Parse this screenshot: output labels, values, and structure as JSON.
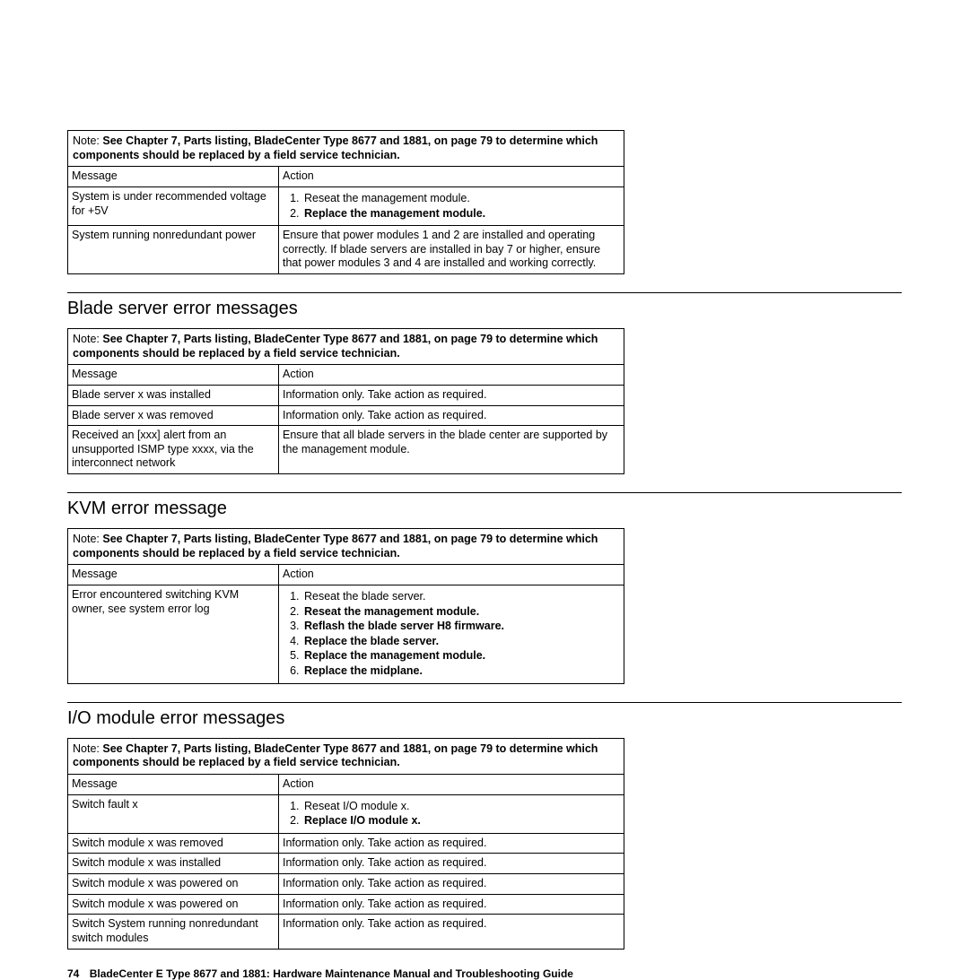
{
  "note": {
    "label": "Note:",
    "text": "See Chapter 7, Parts listing, BladeCenter Type 8677 and 1881, on page 79 to determine which components should be replaced by a field service technician."
  },
  "headers": {
    "message": "Message",
    "action": "Action"
  },
  "sections": [
    {
      "title": "",
      "rows": [
        {
          "message": "System is under recommended voltage for +5V",
          "actions": [
            {
              "text": "Reseat the management module.",
              "bold": false
            },
            {
              "text": "Replace the management module.",
              "bold": true
            }
          ]
        },
        {
          "message": "System running nonredundant power",
          "text": "Ensure that power modules 1 and 2 are installed and operating correctly. If blade servers are installed in bay 7 or higher, ensure that power modules 3 and 4 are installed and working correctly."
        }
      ]
    },
    {
      "title": "Blade server error messages",
      "rows": [
        {
          "message": "Blade server x was installed",
          "text": "Information only. Take action as required."
        },
        {
          "message": "Blade server x was removed",
          "text": "Information only. Take action as required."
        },
        {
          "message": "Received an [xxx] alert from an unsupported ISMP type xxxx, via the interconnect network",
          "text": "Ensure that all blade servers in the blade center are supported by the management module."
        }
      ]
    },
    {
      "title": "KVM error message",
      "rows": [
        {
          "message": "Error encountered switching KVM owner, see system error log",
          "actions": [
            {
              "text": "Reseat the blade server.",
              "bold": false
            },
            {
              "text": "Reseat the management module.",
              "bold": true
            },
            {
              "text": "Reflash the blade server H8 firmware.",
              "bold": true
            },
            {
              "text": "Replace the blade server.",
              "bold": true
            },
            {
              "text": "Replace the management module.",
              "bold": true
            },
            {
              "text": "Replace the midplane.",
              "bold": true
            }
          ]
        }
      ]
    },
    {
      "title": "I/O module error messages",
      "rows": [
        {
          "message": "Switch fault x",
          "actions": [
            {
              "text": "Reseat I/O module x.",
              "bold": false
            },
            {
              "text": "Replace I/O module x.",
              "bold": true
            }
          ]
        },
        {
          "message": "Switch module x was removed",
          "text": "Information only. Take action as required."
        },
        {
          "message": "Switch module x was installed",
          "text": "Information only. Take action as required."
        },
        {
          "message": "Switch module x was powered on",
          "text": "Information only. Take action as required."
        },
        {
          "message": "Switch module x was powered on",
          "text": "Information only. Take action as required."
        },
        {
          "message": "Switch System running nonredundant switch modules",
          "text": "Information only. Take action as required."
        }
      ]
    }
  ],
  "footer": {
    "page_number": "74",
    "title": "BladeCenter E Type 8677 and 1881: Hardware Maintenance Manual and Troubleshooting Guide"
  }
}
